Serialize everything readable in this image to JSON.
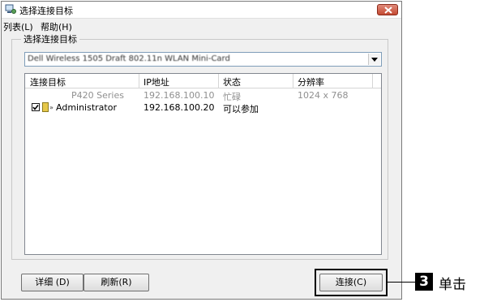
{
  "window": {
    "title": "选择连接目标",
    "menu": [
      {
        "label": "列表(L)"
      },
      {
        "label": "帮助(H)"
      }
    ]
  },
  "target_group": {
    "label": "选择连接目标",
    "combo_value": "Dell Wireless 1505 Draft 802.11n WLAN Mini-Card"
  },
  "list": {
    "columns": [
      "连接目标",
      "IP地址",
      "状态",
      "分辨率"
    ],
    "rows": [
      {
        "checked": false,
        "name": "P420 Series",
        "ip": "192.168.100.10",
        "status": "忙碌",
        "resolution": "1024 x 768",
        "enabled": false
      },
      {
        "checked": true,
        "name": "Administrator",
        "ip": "192.168.100.20",
        "status": "可以参加",
        "resolution": "",
        "enabled": true
      }
    ]
  },
  "buttons": {
    "details": "详细 (D)",
    "refresh": "刷新(R)",
    "connect": "连接(C)"
  },
  "callout": {
    "step": "3",
    "text": "单击"
  }
}
